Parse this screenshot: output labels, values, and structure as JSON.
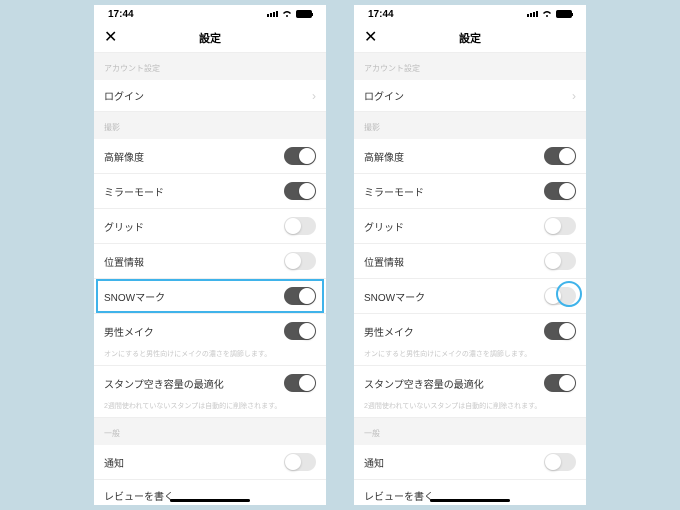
{
  "status": {
    "time": "17:44"
  },
  "nav": {
    "title": "設定",
    "close_glyph": "✕"
  },
  "sections": {
    "account": {
      "header": "アカウント設定",
      "login": "ログイン"
    },
    "shoot": {
      "header": "撮影",
      "highres": "高解像度",
      "mirror": "ミラーモード",
      "grid": "グリッド",
      "location": "位置情報",
      "snowmark": "SNOWマーク",
      "male_makeup": "男性メイク",
      "male_makeup_sub": "オンにすると男性向けにメイクの濃さを調節します。",
      "stamp_opt": "スタンプ空き容量の最適化",
      "stamp_opt_sub": "2週間使われていないスタンプは自動的に削除されます。"
    },
    "general": {
      "header": "一般",
      "notif": "通知",
      "review": "レビューを書く"
    }
  },
  "left": {
    "toggles": {
      "highres": true,
      "mirror": true,
      "grid": false,
      "location": false,
      "snowmark": true,
      "male_makeup": true,
      "stamp_opt": true,
      "notif": false
    }
  },
  "right": {
    "toggles": {
      "highres": true,
      "mirror": true,
      "grid": false,
      "location": false,
      "snowmark": false,
      "male_makeup": true,
      "stamp_opt": true,
      "notif": false
    }
  }
}
